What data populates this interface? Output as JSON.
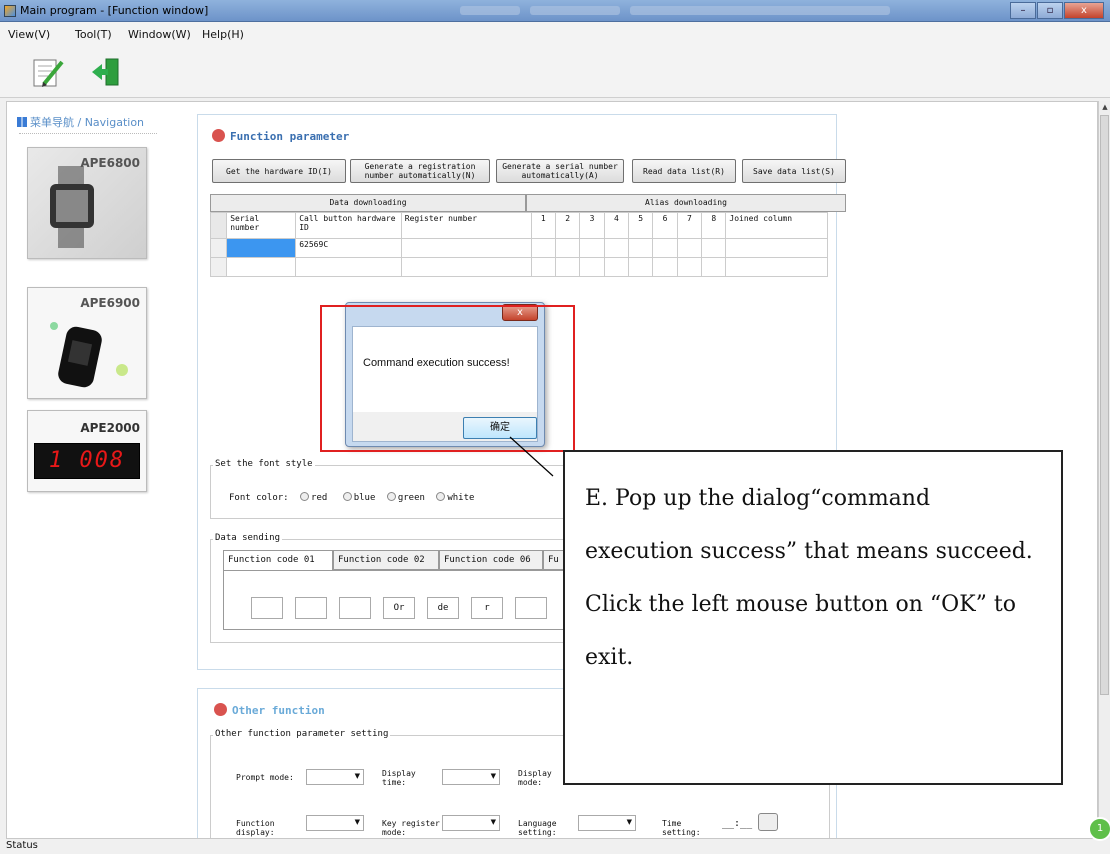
{
  "window": {
    "title": "Main program - [Function window]",
    "buttons": [
      "–",
      "▫",
      "x"
    ]
  },
  "menu": [
    "View(V)",
    "Tool(T)",
    "Window(W)",
    "Help(H)"
  ],
  "toolbar": {
    "icons": [
      "edit-document-icon",
      "exit-door-icon"
    ]
  },
  "nav": {
    "header": "菜单导航 / Navigation",
    "cards": [
      {
        "label": "APE6800"
      },
      {
        "label": "APE6900"
      },
      {
        "label": "APE2000",
        "display": "1 008"
      }
    ]
  },
  "function_panel": {
    "title": "Function parameter",
    "buttons": [
      "Get the hardware ID(I)",
      "Generate a registration number automatically(N)",
      "Generate a serial number automatically(A)",
      "Read data list(R)",
      "Save data list(S)"
    ],
    "downloading_header": "Data downloading",
    "alias_header": "Alias downloading",
    "columns": [
      "Serial number",
      "Call button hardware ID",
      "Register number",
      "1",
      "2",
      "3",
      "4",
      "5",
      "6",
      "7",
      "8",
      "Joined column"
    ],
    "rows": [
      {
        "serial": "",
        "hardware_id": "62569C",
        "register": ""
      },
      {
        "serial": "",
        "hardware_id": "",
        "register": ""
      }
    ],
    "font_style": {
      "title": "Set the font style",
      "label": "Font color:",
      "options": [
        "red",
        "blue",
        "green",
        "white"
      ]
    },
    "data_sending": {
      "title": "Data sending",
      "tabs": [
        "Function code 01",
        "Function code 02",
        "Function code 06",
        "Fu"
      ],
      "fields": [
        "",
        "",
        "",
        "Or",
        "de",
        "r",
        ""
      ]
    }
  },
  "other_panel": {
    "title": "Other function",
    "group_title": "Other function parameter setting",
    "labels": [
      "Prompt mode:",
      "Display time:",
      "Display mode:",
      "Function display:",
      "Key register mode:",
      "Language setting:",
      "Time setting:"
    ],
    "time_value": "__:__"
  },
  "dialog": {
    "message": "Command execution success!",
    "ok_label": "确定",
    "close_label": "x"
  },
  "callout": {
    "text": "E. Pop up the dialog“command execution success” that means succeed. Click the left mouse button on “OK” to exit."
  },
  "status": {
    "text": "Status"
  },
  "colors": {
    "title_accent": "#3a6fb0",
    "red_marker": "#e02020",
    "selected_cell": "#3c96f0"
  }
}
